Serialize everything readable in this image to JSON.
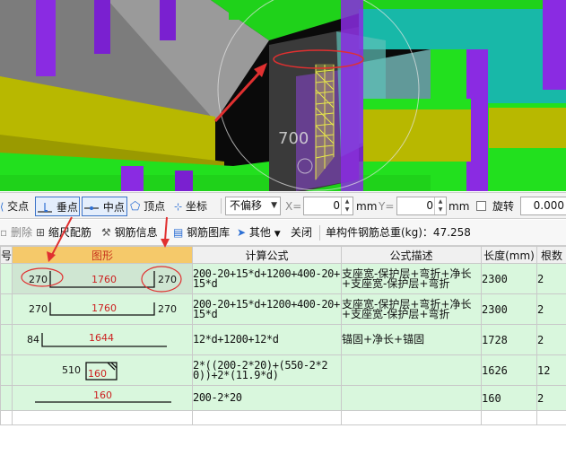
{
  "viewport": {
    "overlay_text": "700"
  },
  "snap_toolbar": {
    "intersection_label": "交点",
    "perpendicular_label": "垂点",
    "midpoint_label": "中点",
    "vertex_label": "顶点",
    "coordinate_label": "坐标",
    "offset_mode": "不偏移",
    "x_label": "X=",
    "x_value": "0",
    "x_unit": "mm",
    "y_label": "Y=",
    "y_value": "0",
    "y_unit": "mm",
    "rotate_label": "旋转",
    "rotate_value": "0.000"
  },
  "rebar_toolbar": {
    "delete_label": "删除",
    "scale_label": "缩尺配筋",
    "info_label": "钢筋信息",
    "library_label": "钢筋图库",
    "other_label": "其他",
    "close_label": "关闭",
    "total_weight_label": "单构件钢筋总重(kg)：47.258"
  },
  "table": {
    "headers": {
      "no": "号",
      "shape": "图形",
      "formula": "计算公式",
      "description": "公式描述",
      "length": "长度(mm)",
      "count": "根数"
    },
    "rows": [
      {
        "shape_left": "270",
        "shape_mid": "1760",
        "shape_right": "270",
        "formula": "200-20+15*d+1200+400-20+15*d",
        "description": "支座宽-保护层+弯折+净长+支座宽-保护层+弯折",
        "length": "2300",
        "count": "2"
      },
      {
        "shape_left": "270",
        "shape_mid": "1760",
        "shape_right": "270",
        "formula": "200-20+15*d+1200+400-20+15*d",
        "description": "支座宽-保护层+弯折+净长+支座宽-保护层+弯折",
        "length": "2300",
        "count": "2"
      },
      {
        "shape_left": "84",
        "shape_mid": "1644",
        "formula": "12*d+1200+12*d",
        "description": "锚固+净长+锚固",
        "length": "1728",
        "count": "2"
      },
      {
        "shape_left": "510",
        "shape_mid": "160",
        "formula": "2*((200-2*20)+(550-2*20))+2*(11.9*d)",
        "description": "",
        "length": "1626",
        "count": "12"
      },
      {
        "shape_mid": "160",
        "formula": "200-2*20",
        "description": "",
        "length": "160",
        "count": "2"
      }
    ]
  },
  "colors": {
    "beam_green": "#22e01e",
    "column_purple": "#8a2be2",
    "slab_yellow": "#b7b700",
    "wall_cyan": "#18b8a8",
    "annotation_red": "#e03030",
    "shape_header_orange": "#f5c96a",
    "row_green": "#d9f7dd"
  }
}
